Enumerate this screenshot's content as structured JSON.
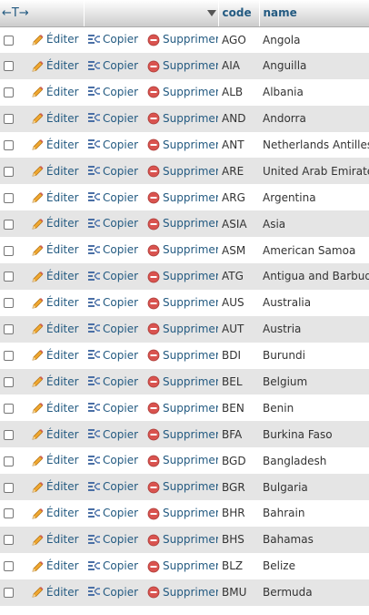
{
  "header": {
    "arrows_label": "←T→",
    "code": "code",
    "name": "name"
  },
  "actions": {
    "edit": "Éditer",
    "copy": "Copier",
    "delete": "Supprimer"
  },
  "rows": [
    {
      "code": "AGO",
      "name": "Angola"
    },
    {
      "code": "AIA",
      "name": "Anguilla"
    },
    {
      "code": "ALB",
      "name": "Albania"
    },
    {
      "code": "AND",
      "name": "Andorra"
    },
    {
      "code": "ANT",
      "name": "Netherlands Antilles"
    },
    {
      "code": "ARE",
      "name": "United Arab Emirates"
    },
    {
      "code": "ARG",
      "name": "Argentina"
    },
    {
      "code": "ASIA",
      "name": "Asia"
    },
    {
      "code": "ASM",
      "name": "American Samoa"
    },
    {
      "code": "ATG",
      "name": "Antigua and Barbuda"
    },
    {
      "code": "AUS",
      "name": "Australia"
    },
    {
      "code": "AUT",
      "name": "Austria"
    },
    {
      "code": "BDI",
      "name": "Burundi"
    },
    {
      "code": "BEL",
      "name": "Belgium"
    },
    {
      "code": "BEN",
      "name": "Benin"
    },
    {
      "code": "BFA",
      "name": "Burkina Faso"
    },
    {
      "code": "BGD",
      "name": "Bangladesh"
    },
    {
      "code": "BGR",
      "name": "Bulgaria"
    },
    {
      "code": "BHR",
      "name": "Bahrain"
    },
    {
      "code": "BHS",
      "name": "Bahamas"
    },
    {
      "code": "BLZ",
      "name": "Belize"
    },
    {
      "code": "BMU",
      "name": "Bermuda"
    }
  ],
  "icons": {
    "edit": "pencil-icon",
    "copy": "copy-icon",
    "delete": "delete-icon",
    "sort": "sort-descending-icon"
  },
  "colors": {
    "link": "#235a81",
    "row_alt": "#e5e5e5",
    "delete": "#d9534f"
  }
}
